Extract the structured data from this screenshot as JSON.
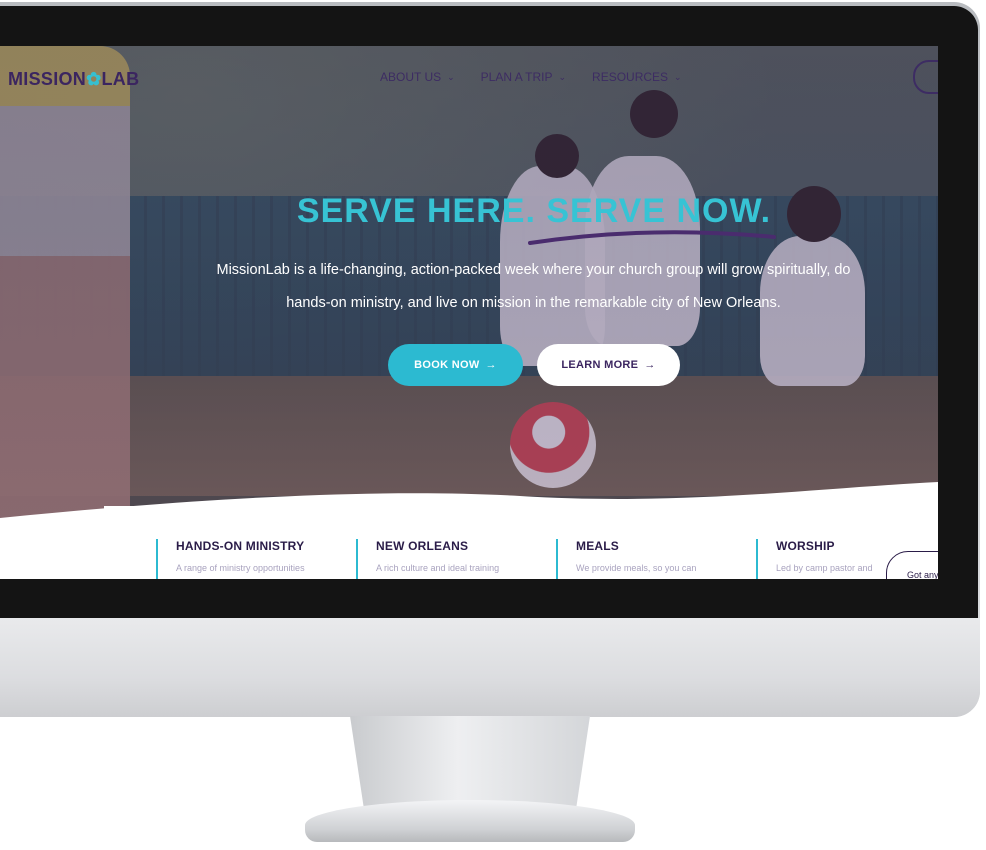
{
  "site": {
    "logo_left": "MISSION",
    "logo_mark": "✿",
    "logo_right": "LAB"
  },
  "nav": {
    "items": [
      {
        "label": "ABOUT US",
        "chevron": "⌄"
      },
      {
        "label": "PLAN A TRIP",
        "chevron": "⌄"
      },
      {
        "label": "RESOURCES",
        "chevron": "⌄"
      }
    ]
  },
  "hero": {
    "title": "SERVE HERE. SERVE NOW.",
    "text": "MissionLab is a life-changing, action-packed week where your church group will grow spiritually, do hands-on ministry, and live on mission in the remarkable city of New Orleans.",
    "book_label": "BOOK NOW",
    "learn_label": "LEARN MORE",
    "arrow": "→"
  },
  "features": [
    {
      "title": "HANDS-ON MINISTRY",
      "text": "A range of ministry opportunities"
    },
    {
      "title": "NEW ORLEANS",
      "text": "A rich culture and ideal training"
    },
    {
      "title": "MEALS",
      "text": "We provide meals, so you can"
    },
    {
      "title": "WORSHIP",
      "text": "Led by camp pastor and"
    }
  ],
  "chat": {
    "label": "Got any"
  },
  "colors": {
    "accent": "#2cbad1",
    "brand": "#3b2560",
    "overlay": "#3a285a"
  }
}
